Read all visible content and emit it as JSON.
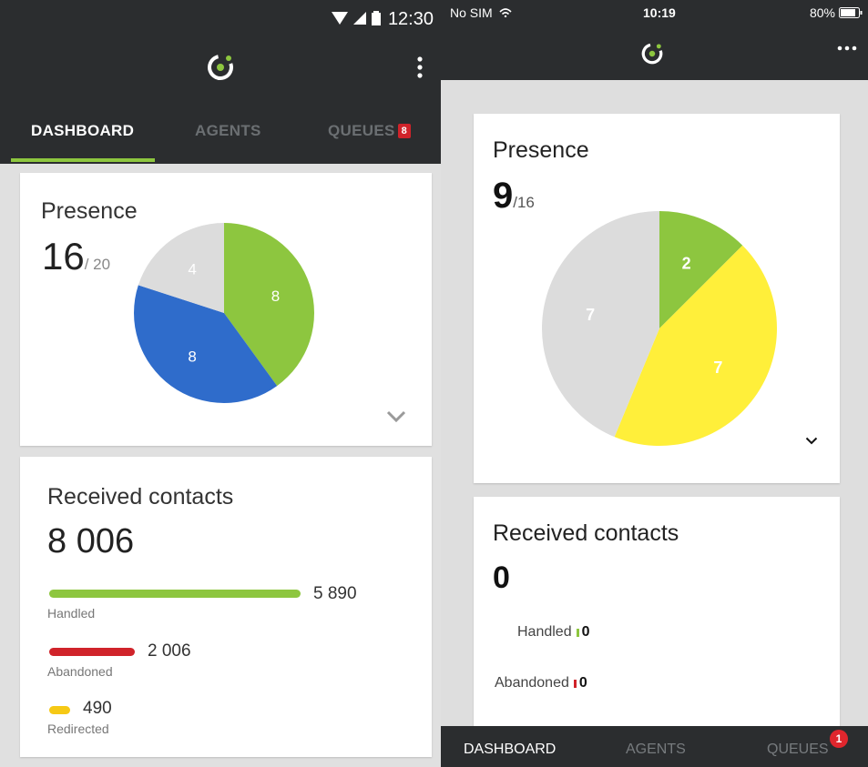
{
  "android": {
    "status_bar": {
      "time": "12:30"
    },
    "tabs": [
      {
        "label": "DASHBOARD",
        "active": true
      },
      {
        "label": "AGENTS",
        "active": false
      },
      {
        "label": "QUEUES",
        "active": false,
        "badge": "8"
      }
    ],
    "presence": {
      "title": "Presence",
      "count": "16",
      "total": "/ 20"
    },
    "received_contacts": {
      "title": "Received contacts",
      "total": "8 006",
      "rows": [
        {
          "label": "Handled",
          "value": "5 890",
          "amount": 5890,
          "color": "#8dc63f"
        },
        {
          "label": "Abandoned",
          "value": "2 006",
          "amount": 2006,
          "color": "#d0232a"
        },
        {
          "label": "Redirected",
          "value": "490",
          "amount": 490,
          "color": "#f6c915"
        }
      ]
    }
  },
  "ios": {
    "status_bar": {
      "carrier": "No SIM",
      "time": "10:19",
      "battery": "80%"
    },
    "presence": {
      "title": "Presence",
      "count": "9",
      "total": "/16"
    },
    "received_contacts": {
      "title": "Received contacts",
      "total": "0",
      "rows": [
        {
          "label": "Handled",
          "value": "0",
          "color": "#8dc63f"
        },
        {
          "label": "Abandoned",
          "value": "0",
          "color": "#d0232a"
        }
      ]
    },
    "bottom_tabs": [
      {
        "label": "DASHBOARD",
        "active": true
      },
      {
        "label": "AGENTS",
        "active": false
      },
      {
        "label": "QUEUES",
        "active": false,
        "badge": "1"
      }
    ]
  },
  "chart_data": [
    {
      "type": "pie",
      "categories": [
        "",
        "",
        ""
      ],
      "values": [
        8,
        8,
        4
      ],
      "colors": [
        "#8dc63f",
        "#2f6ccb",
        "#dcdcdc"
      ],
      "start_angle_deg": 0
    },
    {
      "type": "pie",
      "categories": [
        "",
        "",
        ""
      ],
      "values": [
        2,
        7,
        7
      ],
      "colors": [
        "#8dc63f",
        "#ffef3a",
        "#dcdcdc"
      ],
      "start_angle_deg": 0
    }
  ]
}
